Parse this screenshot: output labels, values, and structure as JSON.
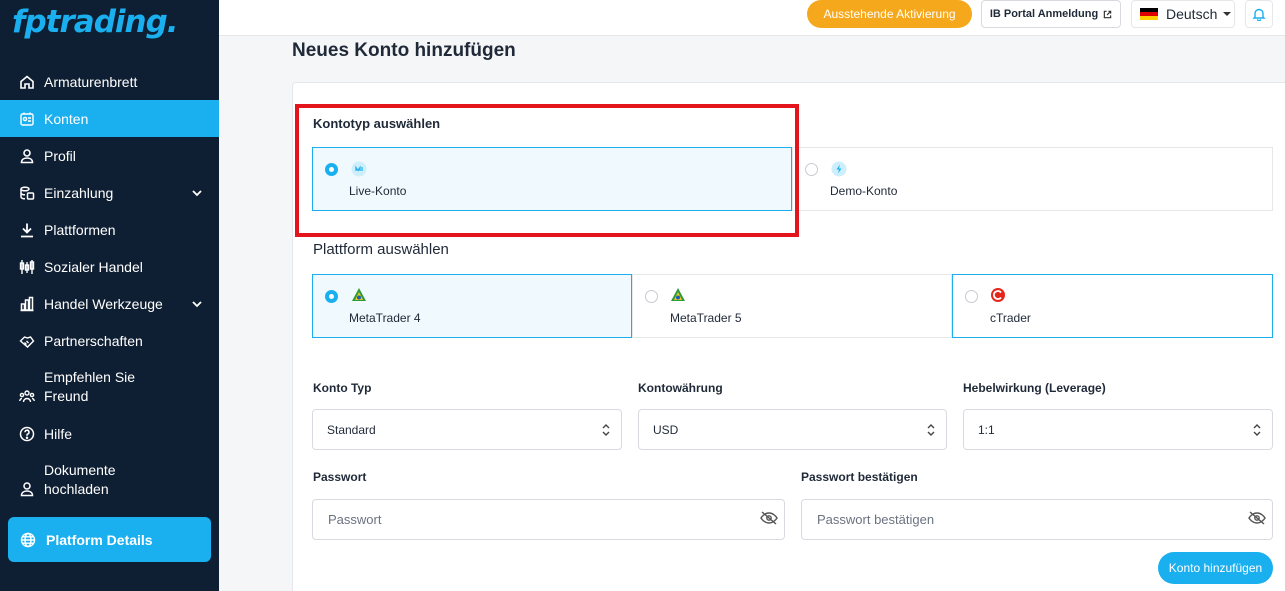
{
  "brand": {
    "logo": "fptrading",
    "logo_dot": "."
  },
  "sidebar": {
    "items": [
      {
        "label": "Armaturenbrett",
        "icon": "home-icon"
      },
      {
        "label": "Konten",
        "icon": "accounts-icon",
        "active": true
      },
      {
        "label": "Profil",
        "icon": "user-icon"
      },
      {
        "label": "Einzahlung",
        "icon": "deposit-icon",
        "expandable": true
      },
      {
        "label": "Plattformen",
        "icon": "download-icon"
      },
      {
        "label": "Sozialer Handel",
        "icon": "social-trading-icon"
      },
      {
        "label": "Handel Werkzeuge",
        "icon": "chart-icon",
        "expandable": true
      },
      {
        "label": "Partnerschaften",
        "icon": "handshake-icon"
      },
      {
        "label": "Empfehlen Sie Freund",
        "icon": "referral-icon"
      },
      {
        "label": "Hilfe",
        "icon": "help-icon"
      },
      {
        "label": "Dokumente hochladen",
        "icon": "upload-docs-icon"
      }
    ],
    "platform_details": "Platform Details"
  },
  "topbar": {
    "pending_activation": "Ausstehende Aktivierung",
    "ib_portal": "IB Portal Anmeldung",
    "language": "Deutsch"
  },
  "page": {
    "title": "Neues Konto hinzufügen"
  },
  "account_type": {
    "label": "Kontotyp auswählen",
    "options": [
      {
        "label": "Live-Konto",
        "selected": true
      },
      {
        "label": "Demo-Konto",
        "selected": false
      }
    ]
  },
  "platform": {
    "label": "Plattform auswählen",
    "options": [
      {
        "label": "MetaTrader 4",
        "selected": true
      },
      {
        "label": "MetaTrader 5",
        "selected": false
      },
      {
        "label": "cTrader",
        "selected": false
      }
    ]
  },
  "form": {
    "konto_typ": {
      "label": "Konto Typ",
      "value": "Standard"
    },
    "currency": {
      "label": "Kontowährung",
      "value": "USD"
    },
    "leverage": {
      "label": "Hebelwirkung (Leverage)",
      "value": "1:1"
    },
    "password": {
      "label": "Passwort",
      "placeholder": "Passwort"
    },
    "password_confirm": {
      "label": "Passwort bestätigen",
      "placeholder": "Passwort bestätigen"
    },
    "submit": "Konto hinzufügen"
  },
  "colors": {
    "accent": "#1ab0f0",
    "sidebar": "#0f1f33",
    "pending": "#f6a81c",
    "highlight": "#e3141b"
  }
}
